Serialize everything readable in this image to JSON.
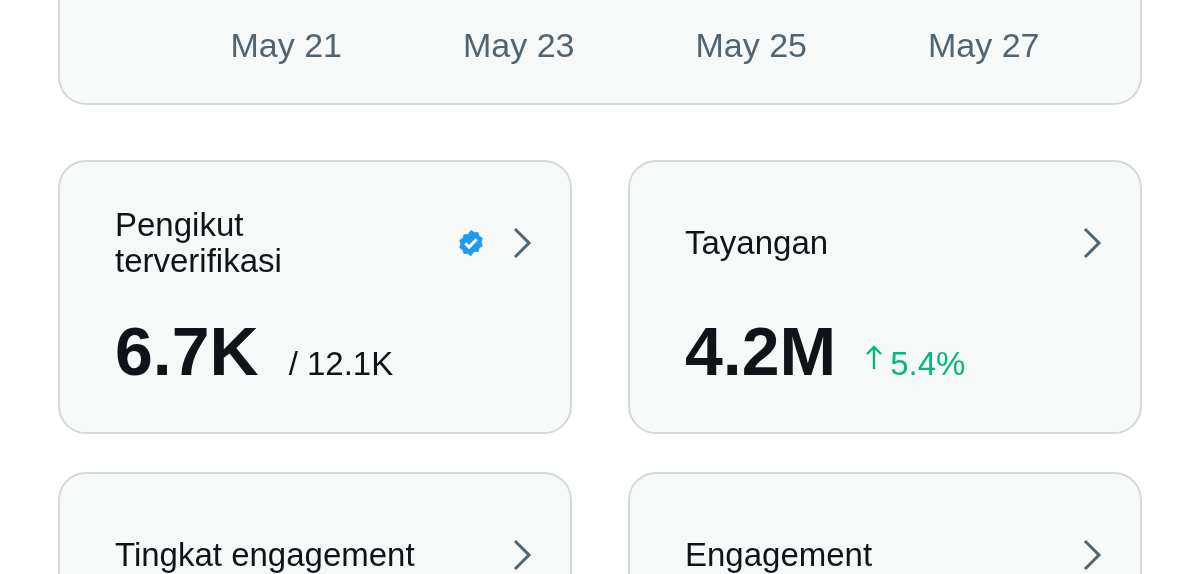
{
  "chart_axis": {
    "labels": [
      "May 21",
      "May 23",
      "May 25",
      "May 27"
    ]
  },
  "cards": [
    {
      "title": "Pengikut terverifikasi",
      "verified": true,
      "value": "6.7K",
      "secondary": "/ 12.1K"
    },
    {
      "title": "Tayangan",
      "verified": false,
      "value": "4.2M",
      "change": "5.4%",
      "rising": true
    },
    {
      "title": "Tingkat engagement",
      "verified": false
    },
    {
      "title": "Engagement",
      "verified": false
    }
  ]
}
